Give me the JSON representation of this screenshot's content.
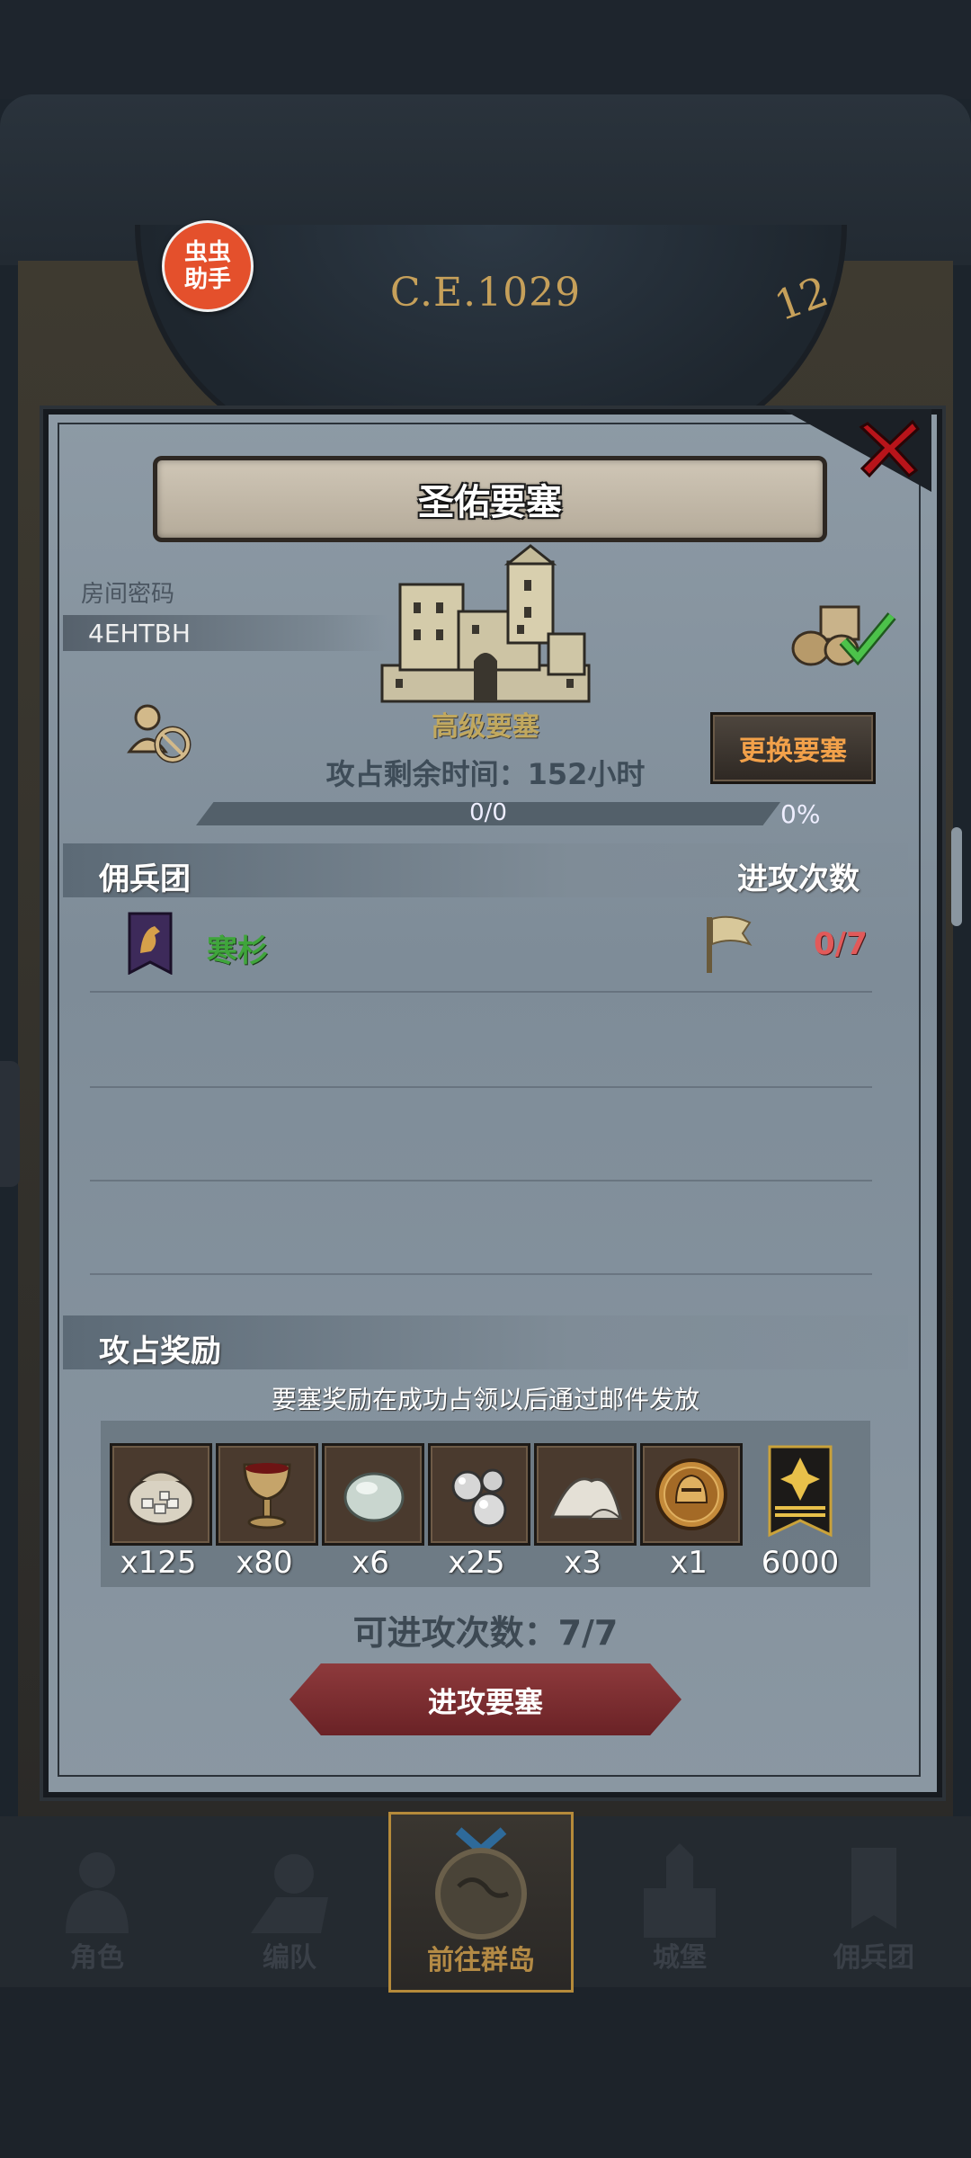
{
  "header": {
    "era": "C.E.1029",
    "clock_number": "12",
    "helper_badge": "虫虫\n助手"
  },
  "dialog": {
    "title": "圣佑要塞",
    "room_password_label": "房间密码",
    "room_password": "4EHTBH",
    "fortress_level": "高级要塞",
    "change_fortress_button": "更换要塞",
    "time_remaining": "攻占剩余时间：152小时",
    "progress_text": "0/0",
    "progress_percent": "0%",
    "progress_fraction": 0,
    "mercenary_header": "佣兵团",
    "attack_count_header": "进攻次数",
    "mercenary_rows": [
      {
        "name": "寒杉",
        "count": "0/7"
      }
    ],
    "reward_header": "攻占奖励",
    "reward_note": "要塞奖励在成功占领以后通过邮件发放",
    "rewards": [
      {
        "icon": "sack-icon",
        "qty": "x125"
      },
      {
        "icon": "goblet-icon",
        "qty": "x80"
      },
      {
        "icon": "moonstone-icon",
        "qty": "x6"
      },
      {
        "icon": "silver-ore-icon",
        "qty": "x25"
      },
      {
        "icon": "salt-pile-icon",
        "qty": "x3"
      },
      {
        "icon": "helmet-medal-icon",
        "qty": "x1"
      },
      {
        "icon": "honor-banner-icon",
        "qty": "6000"
      }
    ],
    "attack_available": "可进攻次数：7/7",
    "attack_button": "进攻要塞"
  },
  "bottom_nav": {
    "items": [
      {
        "label": "角色",
        "icon": "character-icon"
      },
      {
        "label": "编队",
        "icon": "formation-icon"
      },
      {
        "label": "前往群岛",
        "icon": "islands-icon",
        "active": true
      },
      {
        "label": "城堡",
        "icon": "castle-icon"
      },
      {
        "label": "佣兵团",
        "icon": "mercenary-icon"
      }
    ]
  },
  "colors": {
    "accent_orange": "#f2a14a",
    "merc_name_green": "#3fa53b",
    "count_red": "#e15a5a",
    "attack_button": "#8e3a3c"
  }
}
